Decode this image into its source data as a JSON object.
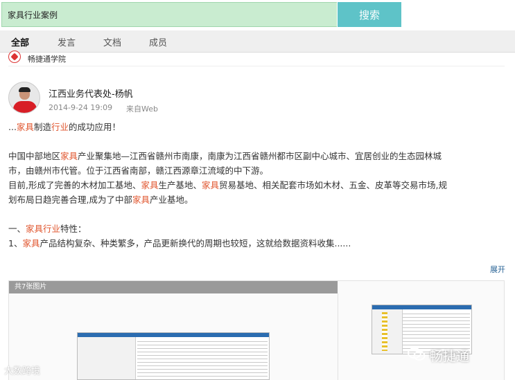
{
  "search": {
    "value": "家具行业案例",
    "button_label": "搜索"
  },
  "tabs": [
    {
      "label": "全部",
      "active": true
    },
    {
      "label": "发言",
      "active": false
    },
    {
      "label": "文档",
      "active": false
    },
    {
      "label": "成员",
      "active": false
    }
  ],
  "source": {
    "name": "畅捷通学院"
  },
  "post": {
    "author": "江西业务代表处-杨帆",
    "time": "2014-9-24 19:09",
    "via": "来自Web",
    "lines": {
      "l1_a": "...",
      "l1_b": "家具",
      "l1_c": "制造",
      "l1_d": "行业",
      "l1_e": "的成功应用！",
      "p2_a": "中国中部地区",
      "p2_b": "家具",
      "p2_c": "产业聚集地—江西省赣州市南康，南康为江西省赣州都市区副中心城市、宜居创业的生态园林城",
      "p2_d": "市，由赣州市代管。位于江西省南部，赣江西源章江流域的中下游。",
      "p3_a": "目前,形成了完善的木材加工基地、",
      "p3_b": "家具",
      "p3_c": "生产基地、",
      "p3_d": "家具",
      "p3_e": "贸易基地、相关配套市场如木材、五金、皮革等交易市场,规",
      "p3_f": "划布局日趋完善合理,成为了中部",
      "p3_g": "家具",
      "p3_h": "产业基地。",
      "p4_a": "一、",
      "p4_b": "家具",
      "p4_c": "行业",
      "p4_d": "特性：",
      "p5_a": "1、",
      "p5_b": "家具",
      "p5_c": "产品结构复杂、种类繁多，产品更新换代的周期也较短，这就给数据资料收集......"
    },
    "expand_label": "展开"
  },
  "gallery": {
    "count_label": "共7张图片"
  },
  "watermarks": {
    "left": "大数跨境",
    "right": "畅捷通"
  },
  "colors": {
    "highlight": "#e0562f",
    "search_bg": "#c9ecd0",
    "search_button": "#5ec3c8",
    "link": "#2a6496"
  },
  "icons": [
    "source-logo-icon",
    "wechat-icon"
  ]
}
